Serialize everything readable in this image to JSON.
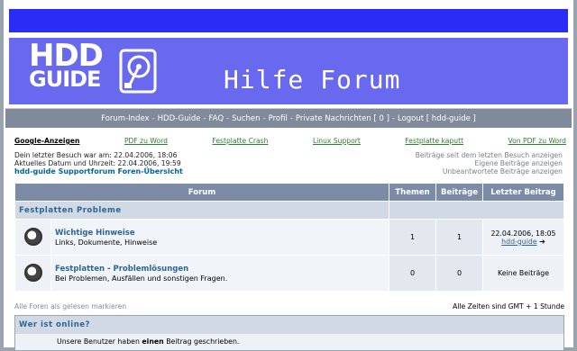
{
  "header": {
    "logo": {
      "line1": "HDD",
      "line2": "GUIDE"
    },
    "title": "Hilfe Forum"
  },
  "nav": {
    "forum_index": "Forum-Index",
    "hdd_guide": "HDD-Guide",
    "faq": "FAQ",
    "search": "Suchen",
    "profile": "Profil",
    "private_messages": "Private Nachrichten [ 0 ]",
    "logout": "Logout [ hdd-guide ]",
    "separator": "-"
  },
  "ads": {
    "title": "Google-Anzeigen",
    "links": [
      "PDF zu Word",
      "Festplatte Crash",
      "Linux Support",
      "Festplatte kaputt",
      "Von PDF zu Word"
    ]
  },
  "info": {
    "last_visit": "Dein letzter Besuch war am: 22.04.2006, 18:06",
    "current_time": "Aktuelles Datum und Uhrzeit: 22.04.2006, 19:59",
    "forum_index_link": "hdd-guide Supportforum Foren-Übersicht",
    "new_posts": "Beiträge seit dem letzten Besuch anzeigen",
    "own_posts": "Eigene Beiträge anzeigen",
    "unanswered": "Unbeantwortete Beiträge anzeigen"
  },
  "table": {
    "headers": {
      "forum": "Forum",
      "topics": "Themen",
      "posts": "Beiträge",
      "last_post": "Letzter Beitrag"
    },
    "category": "Festplatten Probleme",
    "forums": [
      {
        "name": "Wichtige Hinweise",
        "description": "Links, Dokumente, Hinweise",
        "topics": "1",
        "posts": "1",
        "last_post_date": "22.04.2006, 18:05",
        "last_post_user": "hdd-guide",
        "last_post_arrow": "➔"
      },
      {
        "name": "Festplatten - Problemlösungen",
        "description": "Bei Problemen, Ausfällen und sonstigen Fragen.",
        "topics": "0",
        "posts": "0",
        "last_post_text": "Keine Beiträge"
      }
    ]
  },
  "footer": {
    "mark_read": "Alle Foren als gelesen markieren",
    "timezone": "Alle Zeiten sind GMT + 1 Stunde"
  },
  "online": {
    "title": "Wer ist online?",
    "text_before": "Unsere Benutzer haben ",
    "text_bold": "einen",
    "text_after": " Beitrag geschrieben."
  },
  "colors": {
    "top_bar": "#2a2df5",
    "banner": "#6869ee",
    "navbar": "#7f8b9a",
    "table_header": "#7c8ca6",
    "link_blue": "#2e6496",
    "ad_green": "#2f7d32"
  }
}
